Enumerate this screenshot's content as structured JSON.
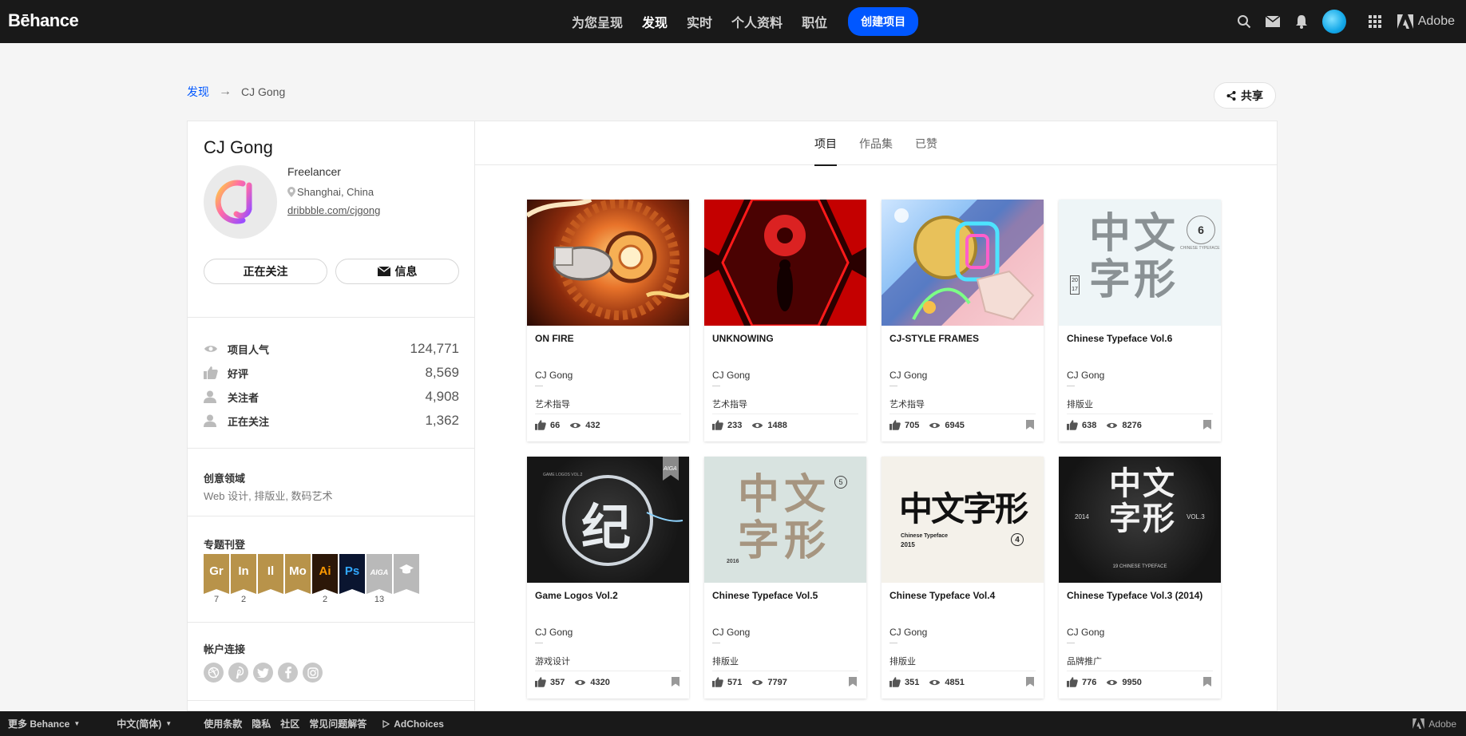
{
  "nav": {
    "logo": "Bēhance",
    "links": [
      "为您呈现",
      "发现",
      "实时",
      "个人资料",
      "职位"
    ],
    "active_index": 1,
    "create_label": "创建项目",
    "adobe_label": "Adobe",
    "accent_color": "#0057ff"
  },
  "breadcrumb": {
    "root": "发现",
    "arrow": "→",
    "current": "CJ Gong"
  },
  "share_label": "共享",
  "profile": {
    "name": "CJ Gong",
    "occupation": "Freelancer",
    "location": "Shanghai, China",
    "website": "dribbble.com/cjgong",
    "follow_label": "正在关注",
    "message_label": "信息",
    "stats": [
      {
        "icon": "eye-icon",
        "label": "项目人气",
        "value": "124,771"
      },
      {
        "icon": "thumbs-up-icon",
        "label": "好评",
        "value": "8,569"
      },
      {
        "icon": "person-icon",
        "label": "关注者",
        "value": "4,908"
      },
      {
        "icon": "person-icon",
        "label": "正在关注",
        "value": "1,362"
      }
    ],
    "fields_title": "创意领域",
    "fields_text": "Web 设计, 排版业, 数码艺术",
    "features_title": "专题刊登",
    "badges": [
      {
        "label": "Gr",
        "count": "7",
        "color": "#b8934a"
      },
      {
        "label": "In",
        "count": "2",
        "color": "#b8934a"
      },
      {
        "label": "Il",
        "count": "",
        "color": "#b8934a"
      },
      {
        "label": "Mo",
        "count": "",
        "color": "#b8934a"
      },
      {
        "label": "Ai",
        "count": "2",
        "color": "#2c1708"
      },
      {
        "label": "Ps",
        "count": "",
        "color": "#0a1530"
      },
      {
        "label": "AIGA",
        "count": "13",
        "color": "#b9b9b9"
      },
      {
        "label": "",
        "count": "",
        "color": "#b9b9b9"
      }
    ],
    "social_title": "帐户连接",
    "social": [
      "dribbble-icon",
      "pinterest-icon",
      "twitter-icon",
      "facebook-icon",
      "instagram-icon"
    ]
  },
  "tabs": [
    "项目",
    "作品集",
    "已赞"
  ],
  "projects": [
    {
      "title": "ON FIRE",
      "owner": "CJ Gong",
      "field": "艺术指导",
      "likes": "66",
      "views": "432"
    },
    {
      "title": "UNKNOWING",
      "owner": "CJ Gong",
      "field": "艺术指导",
      "likes": "233",
      "views": "1488"
    },
    {
      "title": "CJ-STYLE FRAMES",
      "owner": "CJ Gong",
      "field": "艺术指导",
      "likes": "705",
      "views": "6945"
    },
    {
      "title": "Chinese Typeface Vol.6",
      "owner": "CJ Gong",
      "field": "排版业",
      "likes": "638",
      "views": "8276"
    },
    {
      "title": "Game Logos Vol.2",
      "owner": "CJ Gong",
      "field": "游戏设计",
      "likes": "357",
      "views": "4320"
    },
    {
      "title": "Chinese Typeface Vol.5",
      "owner": "CJ Gong",
      "field": "排版业",
      "likes": "571",
      "views": "7797"
    },
    {
      "title": "Chinese Typeface Vol.4",
      "owner": "CJ Gong",
      "field": "排版业",
      "likes": "351",
      "views": "4851"
    },
    {
      "title": "Chinese Typeface Vol.3 (2014)",
      "owner": "CJ Gong",
      "field": "品牌推广",
      "likes": "776",
      "views": "9950"
    }
  ],
  "covers": {
    "vol6_big": "中文\n字形",
    "vol6_num": "6",
    "vol6_ring": "CHINESE TYPEFACE",
    "vol6_year": "2017",
    "game_logo": "纪",
    "game_ring": "GAME LOGOS VOL.2",
    "aiga": "AIGA",
    "vol5_top": "中文",
    "vol5_bottom": "字形",
    "vol5_num": "5",
    "vol5_year": "2016",
    "vol4_big": "中文字形",
    "vol4_sub": "Chinese Typeface",
    "vol4_year": "2015",
    "vol4_num": "4",
    "vol3_big": "中文\n字形",
    "vol3_left": "2014",
    "vol3_right": "VOL.3",
    "vol3_bottom": "19 CHINESE TYPEFACE"
  },
  "footer": {
    "more": "更多 Behance",
    "lang": "中文(简体)",
    "links": [
      "使用条款",
      "隐私",
      "社区",
      "常见问题解答"
    ],
    "adchoices": "AdChoices",
    "adobe": "Adobe"
  }
}
